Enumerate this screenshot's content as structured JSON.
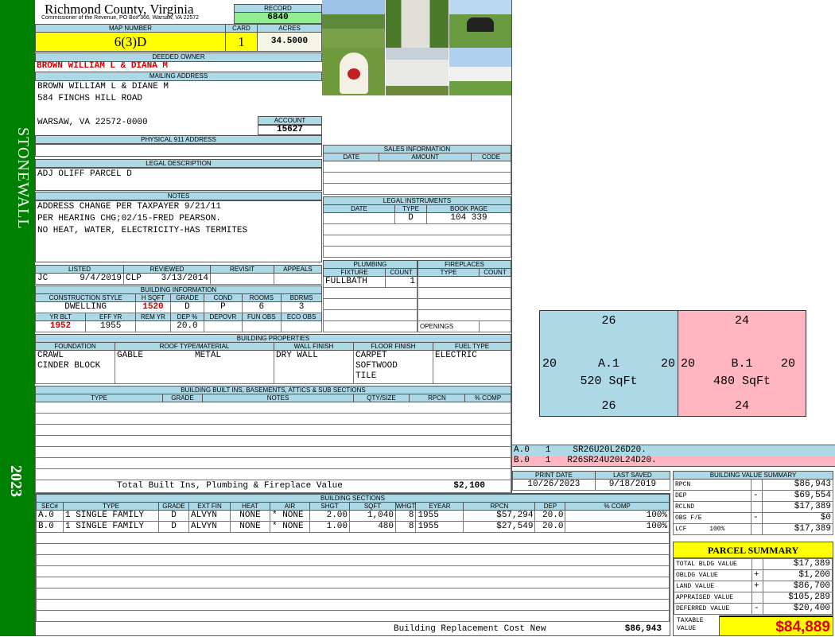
{
  "sidebar": {
    "district": "STONEWALL",
    "year": "2023",
    "color": "#008000"
  },
  "header": {
    "title": "Richmond County, Virginia",
    "subtitle": "Commissioner of the Revenue, PO Box 366, Warsaw, VA 22572",
    "record_label": "RECORD",
    "record": "6840",
    "map_label": "MAP NUMBER",
    "map": "6(3)D",
    "card_label": "CARD",
    "card": "1",
    "acres_label": "ACRES",
    "acres": "34.5000"
  },
  "owner": {
    "label": "DEEDED OWNER",
    "name": "BROWN WILLIAM L & DIANA M"
  },
  "mailing": {
    "label": "MAILING ADDRESS",
    "line1": "BROWN WILLIAM L & DIANE M",
    "line2": "584 FINCHS HILL ROAD",
    "line3": "WARSAW, VA 22572-0000",
    "account_label": "ACCOUNT",
    "account": "15627"
  },
  "physical": {
    "label": "PHYSICAL 911 ADDRESS"
  },
  "legal": {
    "label": "LEGAL DESCRIPTION",
    "text": "ADJ OLIFF PARCEL D"
  },
  "notes": {
    "label": "NOTES",
    "lines": [
      "ADDRESS CHANGE PER TAXPAYER 9/21/11",
      "PER HEARING CHG;02/15-FRED PEARSON.",
      "NO HEAT, WATER, ELECTRICITY-HAS TERMITES"
    ]
  },
  "listing": {
    "listed_label": "LISTED",
    "listed_by": "JC",
    "listed_date": "9/4/2019",
    "reviewed_label": "REVIEWED",
    "reviewed_by": "CLP",
    "reviewed_date": "3/13/2014",
    "revisit_label": "REVISIT",
    "appeals_label": "APPEALS"
  },
  "building_info": {
    "label": "BUILDING INFORMATION",
    "h1": [
      "CONSTRUCTION STYLE",
      "H SQFT",
      "GRADE",
      "COND",
      "ROOMS",
      "BDRMS"
    ],
    "v1": [
      "DWELLING",
      "1520",
      "D",
      "P",
      "6",
      "3"
    ],
    "h2": [
      "YR BLT",
      "EFF YR",
      "REM YR",
      "DEP %",
      "DEPOVR",
      "FUN OBS",
      "ECO OBS"
    ],
    "v2": [
      "1952",
      "1955",
      "",
      "20.0",
      "",
      "",
      ""
    ]
  },
  "photos": [
    "house-exterior",
    "farmhouse",
    "mailbox-584",
    "powells-place-sign",
    "shed",
    "house-front"
  ],
  "sales": {
    "label": "SALES INFORMATION",
    "cols": [
      "DATE",
      "AMOUNT",
      "CODE"
    ]
  },
  "instruments": {
    "label": "LEGAL INSTRUMENTS",
    "cols": [
      "DATE",
      "TYPE",
      "BOOK PAGE"
    ],
    "rows": [
      [
        "",
        "D",
        "104 339"
      ]
    ]
  },
  "plumbing": {
    "label": "PLUMBING",
    "cols": [
      "FIXTURE",
      "COUNT"
    ],
    "rows": [
      [
        "FULLBATH",
        "1"
      ]
    ]
  },
  "fireplaces": {
    "label": "FIREPLACES",
    "cols": [
      "TYPE",
      "COUNT"
    ],
    "openings_label": "OPENINGS"
  },
  "properties": {
    "label": "BUILDING PROPERTIES",
    "cols": [
      "FOUNDATION",
      "ROOF TYPE/MATERIAL",
      "WALL FINISH",
      "FLOOR FINISH",
      "FUEL TYPE"
    ],
    "foundation": [
      "CRAWL",
      "CINDER BLOCK"
    ],
    "roof_type": "GABLE",
    "roof_material": "METAL",
    "wall": "DRY WALL",
    "floor": [
      "CARPET",
      "SOFTWOOD",
      "TILE"
    ],
    "fuel": "ELECTRIC"
  },
  "builtins": {
    "label": "BUILDING BUILT INS, BASEMENTS, ATTICS & SUB SECTIONS",
    "cols": [
      "TYPE",
      "GRADE",
      "NOTES",
      "QTY/SIZE",
      "RPCN",
      "% COMP"
    ],
    "total_label": "Total Built Ins, Plumbing & Fireplace Value",
    "total": "$2,100"
  },
  "sketch": {
    "a": {
      "label": "A.1",
      "area": "520 SqFt",
      "top": "26",
      "bottom": "26",
      "left": "20",
      "right": "20",
      "color": "#add8e6"
    },
    "b": {
      "label": "B.1",
      "area": "480 SqFt",
      "top": "24",
      "bottom": "24",
      "left": "20",
      "right": "20",
      "color": "#ffb6c1"
    },
    "codes": [
      {
        "sec": "A.0",
        "n": "1",
        "code": "SR26U20L26D20."
      },
      {
        "sec": "B.0",
        "n": "1",
        "code": "R26SR24U20L24D20."
      }
    ]
  },
  "dates": {
    "print_label": "PRINT DATE",
    "print": "10/26/2023",
    "saved_label": "LAST SAVED",
    "saved": "9/18/2019"
  },
  "sections": {
    "label": "BUILDING SECTIONS",
    "cols": [
      "SEC#",
      "TYPE",
      "GRADE",
      "EXT FIN",
      "HEAT",
      "AIR",
      "SHGT",
      "SQFT",
      "WHGT",
      "EYEAR",
      "RPCN",
      "DEP",
      "% COMP"
    ],
    "rows": [
      [
        "A.0",
        "1 SINGLE FAMILY",
        "D",
        "ALVYN",
        "NONE",
        "* NONE",
        "2.00",
        "1,040",
        "8",
        "1955",
        "$57,294",
        "20.0",
        "100%"
      ],
      [
        "B.0",
        "1 SINGLE FAMILY",
        "D",
        "ALVYN",
        "NONE",
        "* NONE",
        "1.00",
        "480",
        "8",
        "1955",
        "$27,549",
        "20.0",
        "100%"
      ]
    ],
    "total_label": "Building Replacement Cost New",
    "total": "$86,943"
  },
  "value_summary": {
    "label": "BUILDING VALUE SUMMARY",
    "rows": [
      [
        "RPCN",
        "",
        "$86,943"
      ],
      [
        "DEP",
        "-",
        "$69,554"
      ],
      [
        "RCLND",
        "",
        "$17,389"
      ],
      [
        "OBS F/E",
        "-",
        "$0"
      ],
      [
        "LCF      100%",
        "",
        "$17,389"
      ]
    ]
  },
  "parcel": {
    "label": "PARCEL SUMMARY",
    "rows": [
      [
        "TOTAL BLDG VALUE",
        "",
        "$17,389"
      ],
      [
        "OBLDG VALUE",
        "+",
        "$1,200"
      ],
      [
        "LAND VALUE",
        "+",
        "$86,700"
      ],
      [
        "APPRAISED VALUE",
        "",
        "$105,289"
      ],
      [
        "DEFERRED VALUE",
        "-",
        "$20,400"
      ]
    ],
    "taxable_label": "TAXABLE VALUE",
    "taxable": "$84,889"
  }
}
